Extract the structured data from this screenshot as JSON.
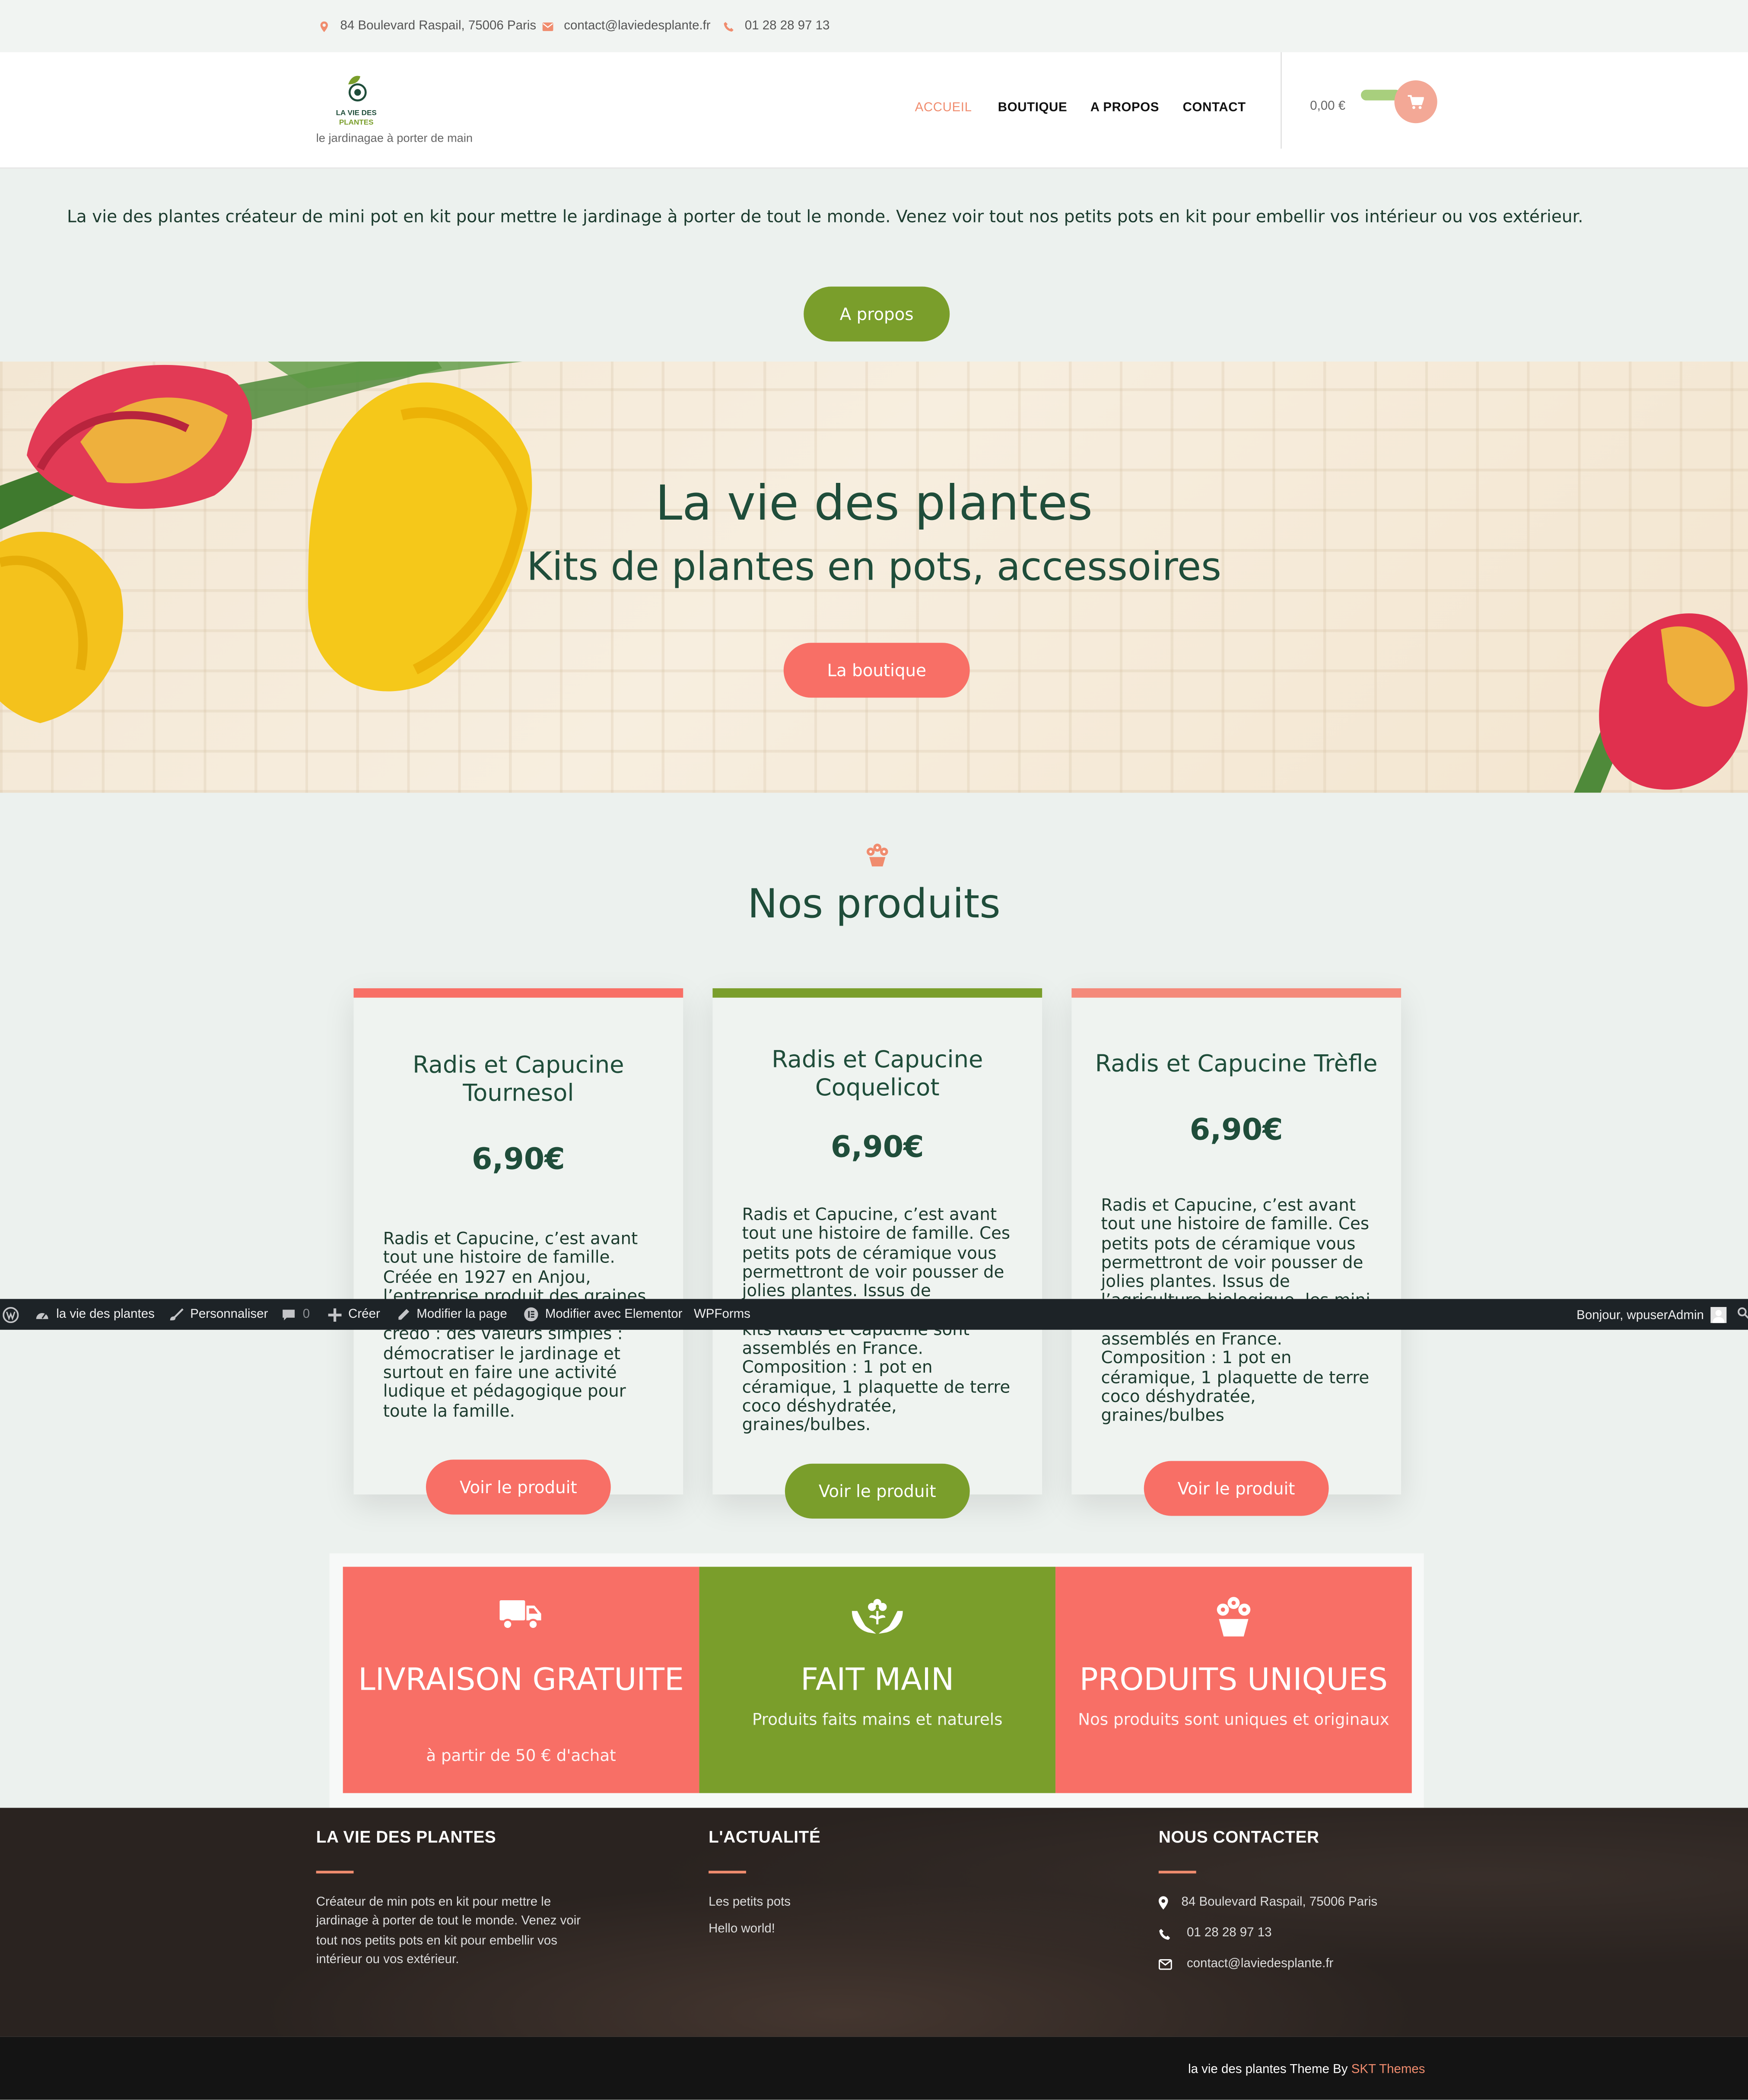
{
  "topbar": {
    "address": "84 Boulevard Raspail, 75006 Paris",
    "email": "contact@laviedesplante.fr",
    "phone": "01 28 28 97 13"
  },
  "header": {
    "logo_line1": "LA VIE DES",
    "logo_line2": "PLANTES",
    "tagline": "le jardinagae à porter de main",
    "nav": [
      "ACCUEIL",
      "BOUTIQUE",
      "A PROPOS",
      "CONTACT"
    ],
    "cart_total": "0,00 €"
  },
  "intro": {
    "text": "La vie des plantes créateur de mini pot en kit pour mettre le jardinage à porter de tout le monde. Venez voir tout nos petits pots en kit pour embellir vos intérieur ou vos extérieur.",
    "button": "A propos"
  },
  "hero": {
    "title": "La vie des plantes",
    "subtitle": "Kits de plantes en pots, accessoires",
    "button": "La boutique"
  },
  "products": {
    "section_title": "Nos produits",
    "items": [
      {
        "title": "Radis et Capucine Tournesol",
        "price": "6,90€",
        "description": "Radis et Capucine, c’est avant tout une histoire de famille. Créée en 1927 en Anjou, l’entreprise produit des graines depuis trois générations. Son credo : des valeurs simples : démocratiser le jardinage et surtout en faire une activité ludique et pédagogique pour toute la famille.",
        "button": "Voir le produit",
        "accent": "#f86f66"
      },
      {
        "title": "Radis et Capucine Coquelicot",
        "price": "6,90€",
        "description": "Radis et Capucine, c’est avant tout une histoire de famille. Ces petits pots de céramique vous permettront de voir pousser de jolies plantes. Issus de l’agriculture biologique, les mini kits Radis et Capucine sont assemblés en France. Composition : 1 pot en céramique, 1 plaquette de terre coco déshydratée, graines/bulbes.",
        "button": "Voir le produit",
        "accent": "#7a9e2b"
      },
      {
        "title": "Radis et Capucine Trèfle",
        "price": "6,90€",
        "description": "Radis et Capucine, c’est avant tout une histoire de famille. Ces petits pots de céramique vous permettront de voir pousser de jolies plantes. Issus de l’agriculture biologique, les mini kits Radis et Capucine sont assemblés en France. Composition : 1 pot en céramique, 1 plaquette de terre coco déshydratée, graines/bulbes",
        "button": "Voir le produit",
        "accent": "#f4897a"
      }
    ]
  },
  "adminbar": {
    "site": "la vie des plantes",
    "customize": "Personnaliser",
    "comments": "0",
    "new": "Créer",
    "edit": "Modifier la page",
    "elementor": "Modifier avec Elementor",
    "wpforms": "WPForms",
    "greeting": "Bonjour, wpuserAdmin"
  },
  "features": [
    {
      "title": "LIVRAISON GRATUITE",
      "subtitle": "à partir de 50 € d'achat",
      "icon": "truck-icon",
      "color": "#f86f66"
    },
    {
      "title": "FAIT MAIN",
      "subtitle": "Produits faits mains et naturels",
      "icon": "hands-flower-icon",
      "color": "#7a9e2b"
    },
    {
      "title": "PRODUITS UNIQUES",
      "subtitle": "Nos produits sont uniques et originaux",
      "icon": "flower-pot-icon",
      "color": "#f86f66"
    }
  ],
  "footer": {
    "col1_title": "LA VIE DES PLANTES",
    "col1_text": "Créateur de min pots en kit pour mettre le jardinage à porter de tout le monde. Venez voir tout nos petits pots en kit pour embellir vos intérieur ou vos extérieur.",
    "col2_title": "L'ACTUALITÉ",
    "col2_links": [
      "Les petits pots",
      "Hello world!"
    ],
    "col3_title": "NOUS CONTACTER",
    "address": "84 Boulevard Raspail, 75006 Paris",
    "phone": "01 28 28 97 13",
    "email": "contact@laviedesplante.fr",
    "credit_prefix": "la vie des plantes Theme By",
    "credit_link": "SKT Themes"
  }
}
